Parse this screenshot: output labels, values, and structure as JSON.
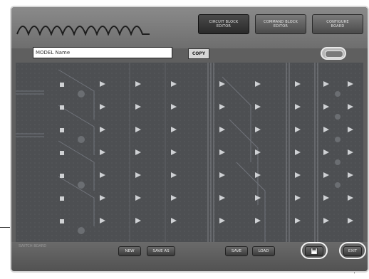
{
  "header": {
    "buttons": [
      {
        "label": "CIRCUIT BLOCK\nEDITOR",
        "active": true
      },
      {
        "label": "COMMAND BLOCK\nEDITOR",
        "active": false
      },
      {
        "label": "CONFIGURE\nBOARD",
        "active": false
      }
    ]
  },
  "name_field": {
    "value": "MODEL Name"
  },
  "copy_button": {
    "label": "COPY"
  },
  "footer": {
    "label": "SWITCH BOARD",
    "buttons": {
      "new": "NEW",
      "save_as": "SAVE AS",
      "save": "SAVE",
      "load": "LOAD",
      "exit": "EXIT"
    }
  },
  "icons": {
    "disk": "floppy-disk-icon",
    "oval": "toggle-icon"
  },
  "colors": {
    "board": "#4d4f52",
    "frame": "#d8d8d8"
  }
}
